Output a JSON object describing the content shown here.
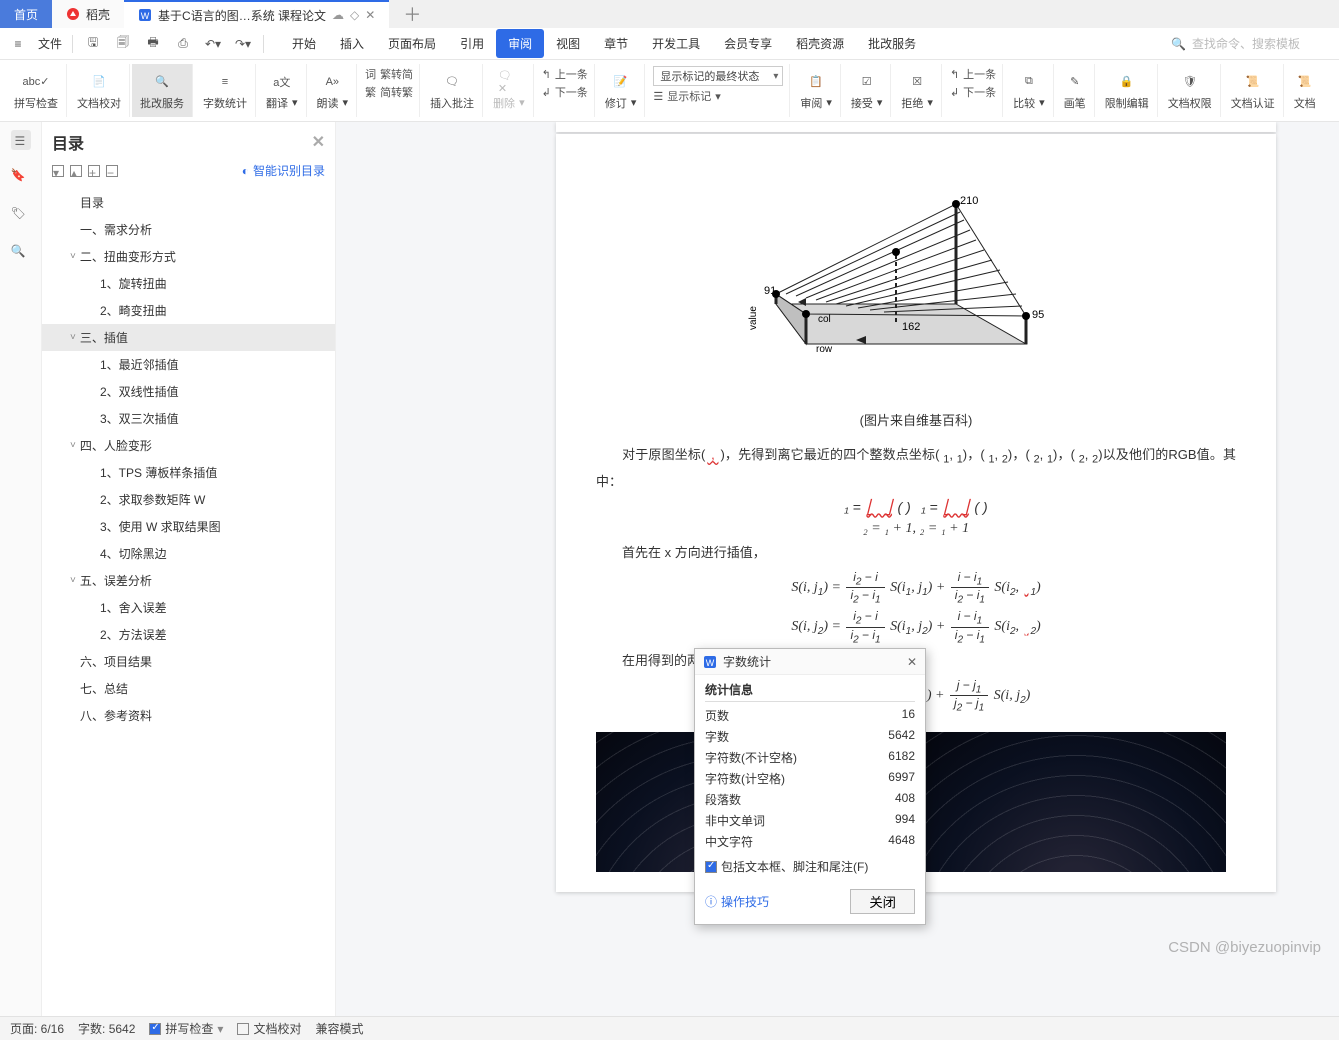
{
  "titlebar": {
    "home": "首页",
    "docker": "稻壳",
    "doc_title": "基于C语言的图…系统 课程论文"
  },
  "menubar": {
    "file": "文件",
    "menus": [
      "开始",
      "插入",
      "页面布局",
      "引用",
      "审阅",
      "视图",
      "章节",
      "开发工具",
      "会员专享",
      "稻壳资源",
      "批改服务"
    ],
    "active_index": 4,
    "search_placeholder": "查找命令、搜索模板"
  },
  "ribbon": {
    "spellcheck": "拼写检查",
    "doc_compare": "文档校对",
    "review_service": "批改服务",
    "word_count": "字数统计",
    "translate": "翻译",
    "read": "朗读",
    "s2t": "繁转简",
    "t2s": "简转繁",
    "insert_comment": "插入批注",
    "delete": "删除",
    "prev_comment": "上一条",
    "next_comment": "下一条",
    "track": "修订",
    "display_state": "显示标记的最终状态",
    "show_marks": "显示标记",
    "review": "审阅",
    "accept": "接受",
    "reject": "拒绝",
    "prev_change": "上一条",
    "next_change": "下一条",
    "compare": "比较",
    "pen": "画笔",
    "restrict": "限制编辑",
    "doc_perm": "文档权限",
    "doc_auth": "文档认证",
    "doc_x": "文档"
  },
  "toc": {
    "title": "目录",
    "auto": "智能识别目录",
    "items": [
      {
        "t": "目录",
        "lvl": 0
      },
      {
        "t": "一、需求分析",
        "lvl": 0
      },
      {
        "t": "二、扭曲变形方式",
        "lvl": 0,
        "exp": true
      },
      {
        "t": "1、旋转扭曲",
        "lvl": 1
      },
      {
        "t": "2、畸变扭曲",
        "lvl": 1
      },
      {
        "t": "三、插值",
        "lvl": 0,
        "exp": true,
        "sel": true
      },
      {
        "t": "1、最近邻插值",
        "lvl": 1
      },
      {
        "t": "2、双线性插值",
        "lvl": 1
      },
      {
        "t": "3、双三次插值",
        "lvl": 1
      },
      {
        "t": "四、人脸变形",
        "lvl": 0,
        "exp": true
      },
      {
        "t": "1、TPS 薄板样条插值",
        "lvl": 1
      },
      {
        "t": "2、求取参数矩阵 W",
        "lvl": 1
      },
      {
        "t": "3、使用 W 求取结果图",
        "lvl": 1
      },
      {
        "t": "4、切除黑边",
        "lvl": 1
      },
      {
        "t": "五、误差分析",
        "lvl": 0,
        "exp": true
      },
      {
        "t": "1、舍入误差",
        "lvl": 1
      },
      {
        "t": "2、方法误差",
        "lvl": 1
      },
      {
        "t": "六、项目结果",
        "lvl": 0
      },
      {
        "t": "七、总结",
        "lvl": 0
      },
      {
        "t": "八、参考资料",
        "lvl": 0
      }
    ]
  },
  "doc": {
    "diagram_labels": {
      "v210": "210",
      "v91": "91",
      "v95": "95",
      "v162": "162",
      "value": "value",
      "col": "col",
      "row": "row"
    },
    "caption": "(图片来自维基百科)",
    "para1_a": "对于原图坐标(",
    "para1_b": ")，先得到离它最近的四个整数点坐标(",
    "para1_c": ")，(",
    "para1_d": ")，(",
    "para1_e": ")，(",
    "para1_f": ")以及他们的RGB值。其中：",
    "eq1_a": "₁ =",
    "eq1_b": "(   )",
    "eq1_c": "₁ =",
    "eq1_d": "(   )",
    "eq2": "₂ =    ₁ + 1,    ₂ =    ₁ + 1",
    "para2": "首先在 x 方向进行插值，",
    "para3": "在用得到的两个点在 y 方向进行插值，即可得到结果"
  },
  "dialog": {
    "title": "字数统计",
    "section": "统计信息",
    "rows": [
      {
        "k": "页数",
        "v": "16"
      },
      {
        "k": "字数",
        "v": "5642"
      },
      {
        "k": "字符数(不计空格)",
        "v": "6182"
      },
      {
        "k": "字符数(计空格)",
        "v": "6997"
      },
      {
        "k": "段落数",
        "v": "408"
      },
      {
        "k": "非中文单词",
        "v": "994"
      },
      {
        "k": "中文字符",
        "v": "4648"
      }
    ],
    "checkbox": "包括文本框、脚注和尾注(F)",
    "tips": "操作技巧",
    "close": "关闭"
  },
  "status": {
    "page": "页面: 6/16",
    "words": "字数: 5642",
    "spell": "拼写检查",
    "proof": "文档校对",
    "compat": "兼容模式"
  },
  "watermark": "CSDN @biyezuopinvip"
}
